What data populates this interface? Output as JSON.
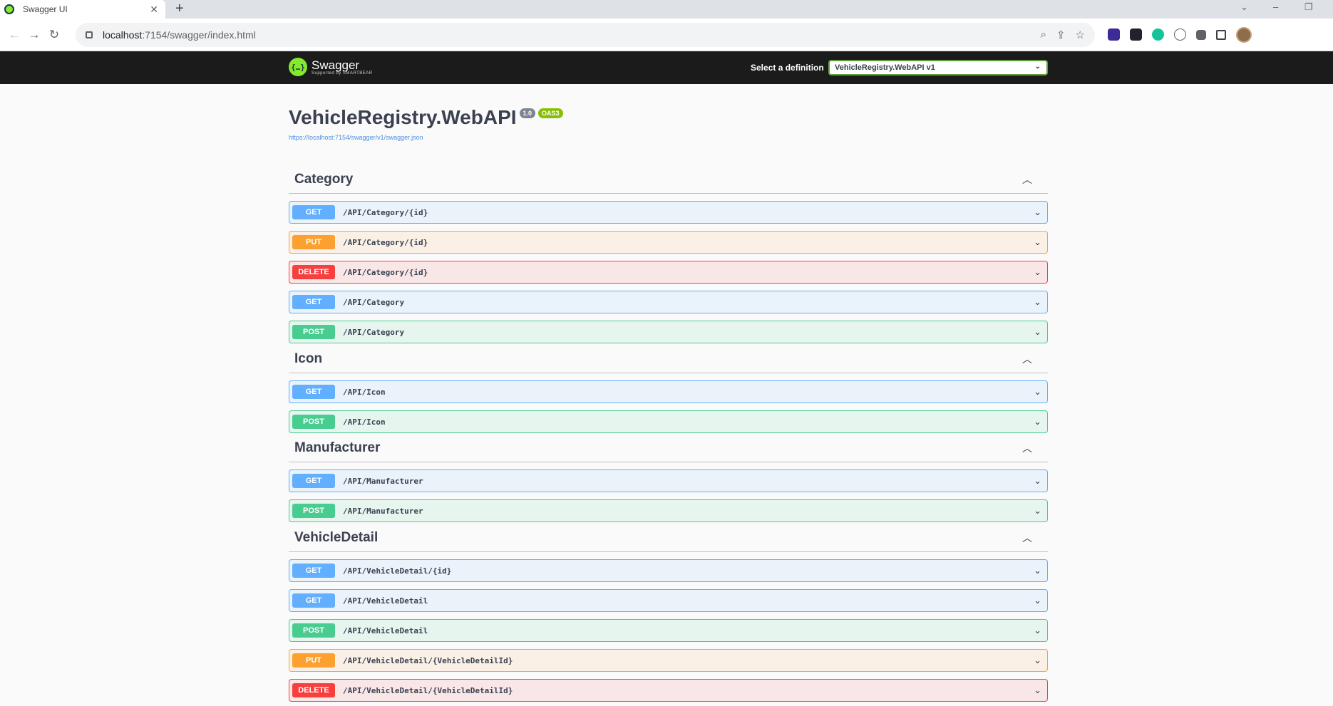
{
  "browser": {
    "tab_title": "Swagger UI",
    "tab_close": "✕",
    "new_tab": "+",
    "url_host": "localhost",
    "url_rest": ":7154/swagger/index.html"
  },
  "topbar": {
    "logo_title": "Swagger",
    "logo_sub": "Supported by SMARTBEAR",
    "definition_label": "Select a definition",
    "definition_value": "VehicleRegistry.WebAPI v1"
  },
  "info": {
    "title": "VehicleRegistry.WebAPI",
    "version": "1.0",
    "oas": "OAS3",
    "spec_url": "https://localhost:7154/swagger/v1/swagger.json"
  },
  "sections": [
    {
      "name": "Category",
      "ops": [
        {
          "method": "GET",
          "path": "/API/Category/{id}"
        },
        {
          "method": "PUT",
          "path": "/API/Category/{id}"
        },
        {
          "method": "DELETE",
          "path": "/API/Category/{id}"
        },
        {
          "method": "GET",
          "path": "/API/Category"
        },
        {
          "method": "POST",
          "path": "/API/Category"
        }
      ]
    },
    {
      "name": "Icon",
      "ops": [
        {
          "method": "GET",
          "path": "/API/Icon"
        },
        {
          "method": "POST",
          "path": "/API/Icon"
        }
      ]
    },
    {
      "name": "Manufacturer",
      "ops": [
        {
          "method": "GET",
          "path": "/API/Manufacturer"
        },
        {
          "method": "POST",
          "path": "/API/Manufacturer"
        }
      ]
    },
    {
      "name": "VehicleDetail",
      "ops": [
        {
          "method": "GET",
          "path": "/API/VehicleDetail/{id}"
        },
        {
          "method": "GET",
          "path": "/API/VehicleDetail"
        },
        {
          "method": "POST",
          "path": "/API/VehicleDetail"
        },
        {
          "method": "PUT",
          "path": "/API/VehicleDetail/{VehicleDetailId}"
        },
        {
          "method": "DELETE",
          "path": "/API/VehicleDetail/{VehicleDetailId}"
        }
      ]
    }
  ]
}
